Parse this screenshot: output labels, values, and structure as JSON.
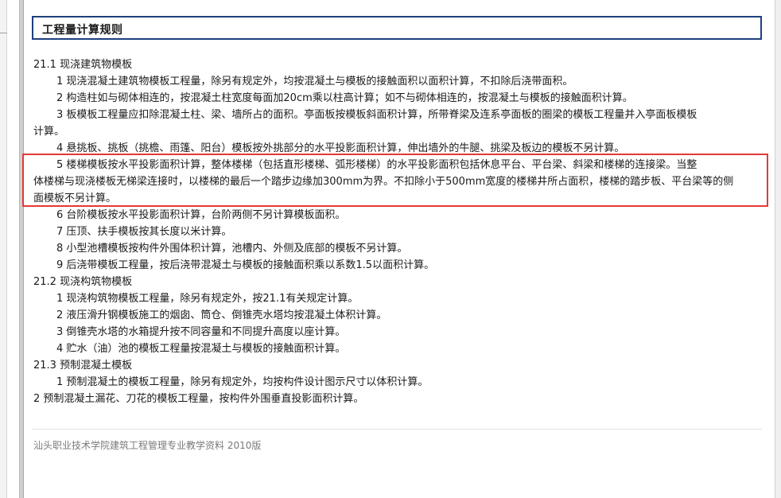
{
  "title": "工程量计算规则",
  "lines": [
    {
      "kind": "section",
      "text": "21.1  现浇建筑物模板"
    },
    {
      "kind": "item",
      "text": "1  现浇混凝土建筑物模板工程量，除另有规定外，均按混凝土与模板的接触面积以面积计算，不扣除后浇带面积。"
    },
    {
      "kind": "item",
      "text": "2  构造柱如与砌体相连的，按混凝土柱宽度每面加20cm乘以柱高计算；如不与砌体相连的，按混凝土与模板的接触面积计算。"
    },
    {
      "kind": "item",
      "text": "3  板模板工程量应扣除混凝土柱、梁、墙所占的面积。亭面板按模板斜面积计算，所带脊梁及连系亭面板的圈梁的模板工程量并入亭面板模板"
    },
    {
      "kind": "cont",
      "text": "计算。"
    },
    {
      "kind": "item",
      "text": "4  悬挑板、挑板（挑檐、雨篷、阳台）模板按外挑部分的水平投影面积计算，伸出墙外的牛腿、挑梁及板边的模板不另计算。"
    },
    {
      "kind": "item",
      "text": "5  楼梯模板按水平投影面积计算，整体楼梯（包括直形楼梯、弧形楼梯）的水平投影面积包括休息平台、平台梁、斜梁和楼梯的连接梁。当整"
    },
    {
      "kind": "cont",
      "text": "体楼梯与现浇楼板无梯梁连接时，以楼梯的最后一个踏步边缘加300mm为界。不扣除小于500mm宽度的楼梯井所占面积，楼梯的踏步板、平台梁等的侧"
    },
    {
      "kind": "cont",
      "text": "面模板不另计算。"
    },
    {
      "kind": "item",
      "text": "6  台阶模板按水平投影面积计算，台阶两侧不另计算模板面积。"
    },
    {
      "kind": "item",
      "text": "7  压顶、扶手模板按其长度以米计算。"
    },
    {
      "kind": "item",
      "text": "8  小型池槽模板按构件外围体积计算，池槽内、外侧及底部的模板不另计算。"
    },
    {
      "kind": "item",
      "text": "9  后浇带模板工程量，按后浇带混凝土与模板的接触面积乘以系数1.5以面积计算。"
    },
    {
      "kind": "section",
      "text": "21.2  现浇构筑物模板"
    },
    {
      "kind": "item",
      "text": "1  现浇构筑物模板工程量，除另有规定外，按21.1有关规定计算。"
    },
    {
      "kind": "item",
      "text": "2  液压滑升钢模板施工的烟囱、筒仓、倒锥壳水塔均按混凝土体积计算。"
    },
    {
      "kind": "item",
      "text": "3  倒锥壳水塔的水箱提升按不同容量和不同提升高度以座计算。"
    },
    {
      "kind": "item",
      "text": "4  贮水（油）池的模板工程量按混凝土与模板的接触面积计算。"
    },
    {
      "kind": "section",
      "text": "21.3  预制混凝土模板"
    },
    {
      "kind": "item",
      "text": "1  预制混凝土的模板工程量，除另有规定外，均按构件设计图示尺寸以体积计算。"
    },
    {
      "kind": "cont",
      "text": "2  预制混凝土漏花、刀花的模板工程量，按构件外围垂直投影面积计算。"
    }
  ],
  "footer": "汕头职业技术学院建筑工程管理专业教学资料 2010版",
  "colors": {
    "title_border": "#1f3f7e",
    "highlight_border": "#e53935",
    "text": "#1a1a1a",
    "footer_text": "#7a7a7a"
  }
}
